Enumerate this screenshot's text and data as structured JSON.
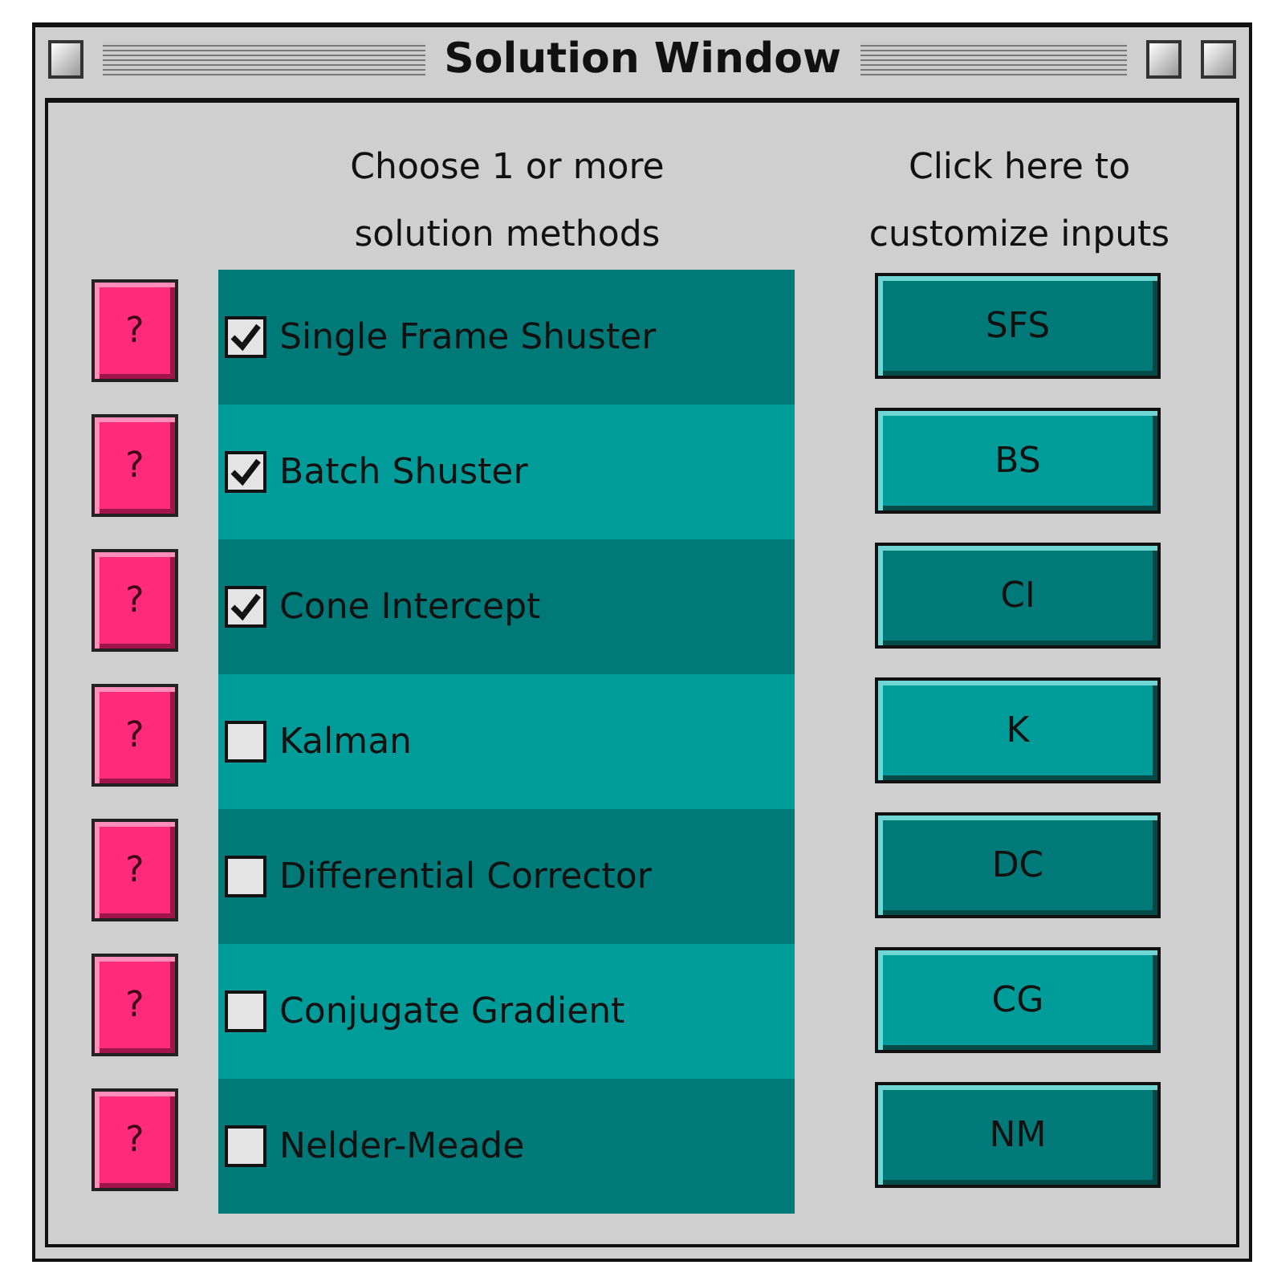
{
  "window": {
    "title": "Solution Window"
  },
  "headers": {
    "methods": "Choose 1 or more solution methods",
    "inputs": "Click here to customize inputs"
  },
  "methods": [
    {
      "help": "?",
      "label": "Single Frame Shuster",
      "checked": true,
      "button": "SFS"
    },
    {
      "help": "?",
      "label": "Batch Shuster",
      "checked": true,
      "button": "BS"
    },
    {
      "help": "?",
      "label": "Cone Intercept",
      "checked": true,
      "button": "CI"
    },
    {
      "help": "?",
      "label": "Kalman",
      "checked": false,
      "button": "K"
    },
    {
      "help": "?",
      "label": "Differential Corrector",
      "checked": false,
      "button": "DC"
    },
    {
      "help": "?",
      "label": "Conjugate Gradient",
      "checked": false,
      "button": "CG"
    },
    {
      "help": "?",
      "label": "Nelder-Meade",
      "checked": false,
      "button": "NM"
    }
  ]
}
